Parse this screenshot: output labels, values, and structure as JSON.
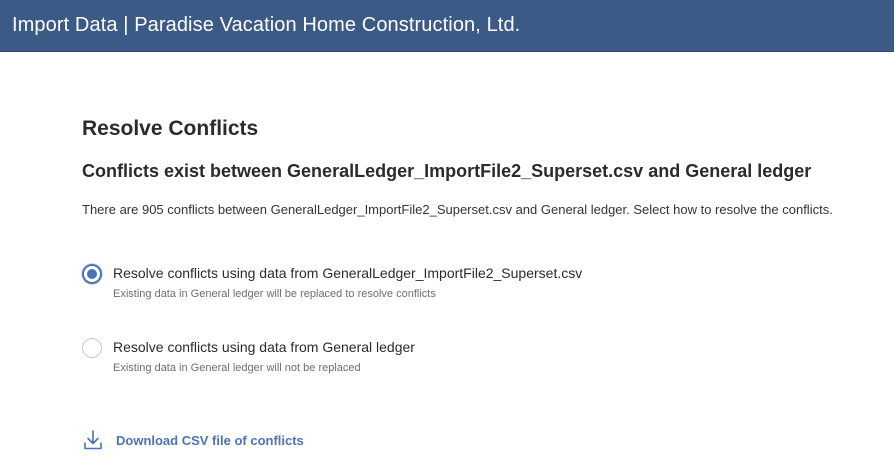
{
  "header": {
    "title": "Import Data | Paradise Vacation Home Construction, Ltd."
  },
  "main": {
    "page_title": "Resolve Conflicts",
    "subtitle": "Conflicts exist between GeneralLedger_ImportFile2_Superset.csv and General ledger",
    "description": "There are 905 conflicts between GeneralLedger_ImportFile2_Superset.csv and General ledger. Select how to resolve the conflicts.",
    "options": [
      {
        "label": "Resolve conflicts using data from GeneralLedger_ImportFile2_Superset.csv",
        "hint": "Existing data in General ledger will be replaced to resolve conflicts",
        "selected": true
      },
      {
        "label": "Resolve conflicts using data from General ledger",
        "hint": "Existing data in General ledger will not be replaced",
        "selected": false
      }
    ],
    "download": {
      "label": "Download CSV file of conflicts",
      "icon": "download-icon"
    }
  },
  "colors": {
    "header_bg": "#3b5a85",
    "accent": "#4a73b8"
  }
}
